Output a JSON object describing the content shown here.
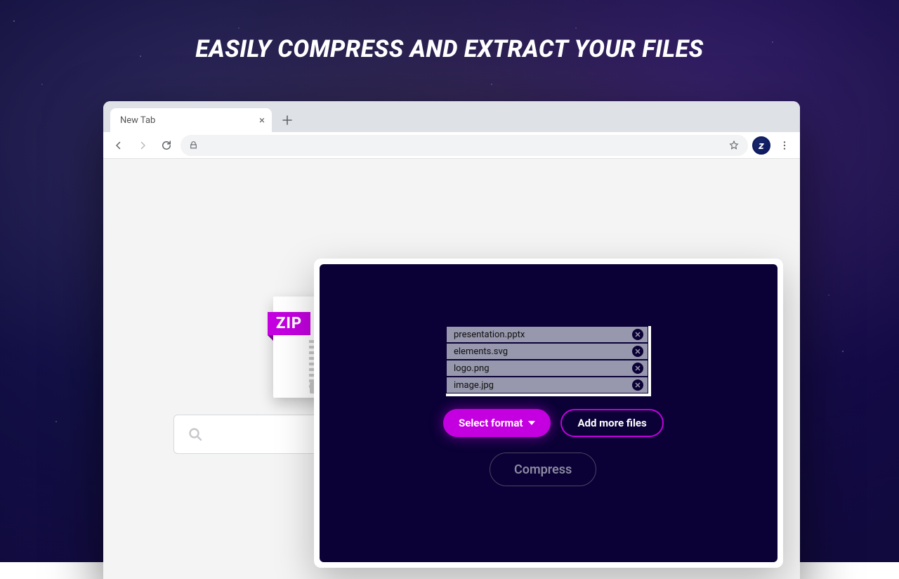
{
  "headline": "EASILY COMPRESS AND EXTRACT YOUR FILES",
  "browser": {
    "tab_title": "New Tab",
    "extension_badge_letter": "z"
  },
  "zip_icon_label": "ZIP",
  "popup": {
    "files": [
      {
        "name": "presentation.pptx"
      },
      {
        "name": "elements.svg"
      },
      {
        "name": "logo.png"
      },
      {
        "name": "image.jpg"
      }
    ],
    "select_format_label": "Select format",
    "add_more_label": "Add more files",
    "compress_label": "Compress"
  },
  "colors": {
    "accent": "#c400e0",
    "panel_bg": "#0b0136"
  }
}
